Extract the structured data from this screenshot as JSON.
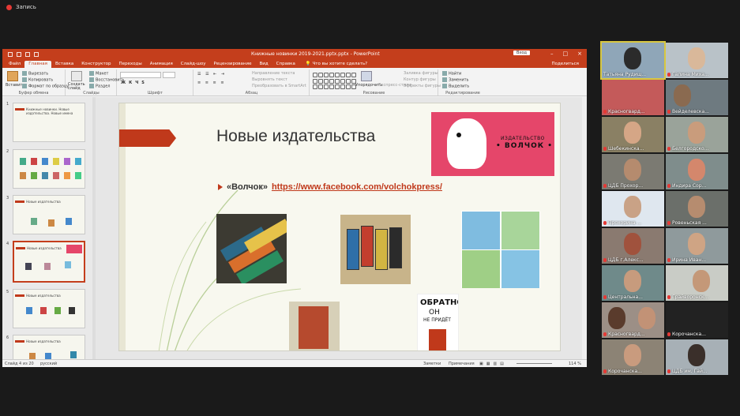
{
  "recording": {
    "label": "Запись"
  },
  "ppt": {
    "doc_title": "Книжные новинки 2019-2021.pptx.pptx - PowerPoint",
    "signin_label": "Вход",
    "tabs": [
      "Файл",
      "Главная",
      "Вставка",
      "Конструктор",
      "Переходы",
      "Анимация",
      "Слайд-шоу",
      "Рецензирование",
      "Вид",
      "Справка"
    ],
    "active_tab": "Главная",
    "tell_me": "Что вы хотите сделать?",
    "share_label": "Поделиться",
    "ribbon": {
      "paste": "Вставить",
      "cut": "Вырезать",
      "copy": "Копировать",
      "format_painter": "Формат по образцу",
      "clipboard_group": "Буфер обмена",
      "new_slide": "Создать слайд",
      "layout": "Макет",
      "reset": "Восстановить",
      "section": "Раздел",
      "slides_group": "Слайды",
      "font_group": "Шрифт",
      "text_direction": "Направление текста",
      "align_text": "Выровнять текст",
      "smartart": "Преобразовать в SmartArt",
      "paragraph_group": "Абзац",
      "arrange": "Упорядочить",
      "quick_styles": "Экспресс-стили",
      "shape_fill": "Заливка фигуры",
      "shape_outline": "Контур фигуры",
      "shape_effects": "Эффекты фигуры",
      "drawing_group": "Рисование",
      "find": "Найти",
      "replace": "Заменить",
      "select": "Выделить",
      "editing_group": "Редактирование"
    },
    "thumbs": [
      {
        "num": "1",
        "title": "Книжные новинки. Новые издательства. Новые имена"
      },
      {
        "num": "2",
        "title": ""
      },
      {
        "num": "3",
        "title": "Новые издательства"
      },
      {
        "num": "4",
        "title": "Новые издательства"
      },
      {
        "num": "5",
        "title": "Новые издательства"
      },
      {
        "num": "6",
        "title": "Новые издательства"
      }
    ],
    "slide": {
      "title": "Новые издательства",
      "publisher": "«Волчок»",
      "url": "https://www.facebook.com/volchokpress/",
      "logo_line1": "ИЗДАТЕЛЬСТВО",
      "logo_line2": "• ВОЛЧОК •",
      "book5_line1": "ОБРАТНО",
      "book5_line2": "ОН",
      "book5_line3": "НЕ ПРИДЁТ"
    },
    "status": {
      "slide_of": "Слайд 4 из 20",
      "language": "русский",
      "notes": "Заметки",
      "comments": "Примечания",
      "zoom": "114 %"
    }
  },
  "participants": [
    "Татьяна Рудищ...",
    "Галина Миха...",
    "Красногвард...",
    "Вейделевска...",
    "Шебекинска...",
    "Белгородско...",
    "ЦДБ Прохор...",
    "Индира Сор...",
    "Прохорина ...",
    "Ровеньская ...",
    "ЦДБ г.Алекс...",
    "Ирина Иван...",
    "Центральна...",
    "Грайворонск...",
    "Красногвард...",
    "Корочанска...",
    "Корочанска...",
    "ЦДБ им. Гай..."
  ],
  "colors": {
    "ppt_accent": "#c43e1c",
    "slide_red": "#c0391b",
    "logo_pink": "#e5466a",
    "active_speaker": "#d8c740"
  }
}
